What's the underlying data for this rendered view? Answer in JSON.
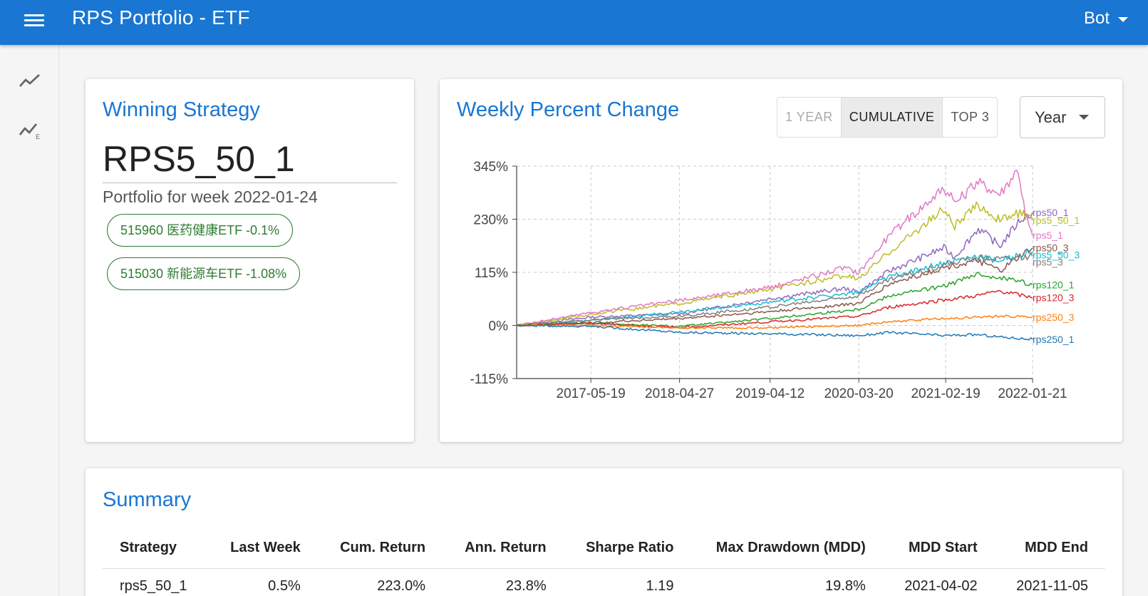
{
  "app": {
    "title": "RPS Portfolio - ETF",
    "user": "Bot"
  },
  "icons": {
    "menu": "hamburger-menu-icon",
    "nav_1": "trending-line-icon",
    "nav_2": "trending-line-e-icon"
  },
  "winning": {
    "title": "Winning Strategy",
    "strategy": "RPS5_50_1",
    "subtitle": "Portfolio for week 2022-01-24",
    "holdings": [
      "515960 医药健康ETF -0.1%",
      "515030 新能源车ETF -1.08%"
    ]
  },
  "chart_panel": {
    "title": "Weekly Percent Change",
    "toggles": [
      {
        "label": "1 YEAR",
        "state": "disabled"
      },
      {
        "label": "CUMULATIVE",
        "state": "active"
      },
      {
        "label": "TOP 3",
        "state": "normal"
      }
    ],
    "period_select": "Year"
  },
  "chart_data": {
    "type": "line",
    "title": "",
    "xlabel": "",
    "ylabel": "",
    "ylim": [
      -115,
      345
    ],
    "yticks": [
      -115,
      0,
      115,
      230,
      345
    ],
    "ytick_labels": [
      "-115%",
      "0%",
      "115%",
      "230%",
      "345%"
    ],
    "xticks": [
      "2017-05-19",
      "2018-04-27",
      "2019-04-12",
      "2020-03-20",
      "2021-02-19",
      "2022-01-21"
    ],
    "xlim": [
      "2016-08-05",
      "2022-01-21"
    ],
    "grid": true,
    "legend": "labels at line ends (right)",
    "series": [
      {
        "name": "rps50_1",
        "color": "#9467bd",
        "points": [
          [
            "2016-08-05",
            0
          ],
          [
            "2017-05-19",
            18
          ],
          [
            "2018-04-27",
            25
          ],
          [
            "2019-04-12",
            58
          ],
          [
            "2020-01-24",
            80
          ],
          [
            "2020-03-20",
            72
          ],
          [
            "2020-07-17",
            118
          ],
          [
            "2021-02-12",
            168
          ],
          [
            "2021-03-26",
            148
          ],
          [
            "2021-06-25",
            210
          ],
          [
            "2021-09-17",
            172
          ],
          [
            "2021-12-03",
            228
          ],
          [
            "2022-01-21",
            245
          ]
        ]
      },
      {
        "name": "rps5_50_1",
        "color": "#bcbd22",
        "points": [
          [
            "2016-08-05",
            0
          ],
          [
            "2017-05-19",
            24
          ],
          [
            "2018-04-27",
            48
          ],
          [
            "2019-04-12",
            78
          ],
          [
            "2020-01-24",
            108
          ],
          [
            "2020-03-20",
            100
          ],
          [
            "2020-07-17",
            160
          ],
          [
            "2021-02-12",
            252
          ],
          [
            "2021-03-26",
            215
          ],
          [
            "2021-06-25",
            262
          ],
          [
            "2021-09-17",
            228
          ],
          [
            "2021-12-03",
            245
          ],
          [
            "2022-01-21",
            228
          ]
        ]
      },
      {
        "name": "rps5_1",
        "color": "#e377c2",
        "points": [
          [
            "2016-08-05",
            0
          ],
          [
            "2017-05-19",
            28
          ],
          [
            "2018-04-27",
            54
          ],
          [
            "2019-04-12",
            82
          ],
          [
            "2020-01-24",
            125
          ],
          [
            "2020-03-20",
            115
          ],
          [
            "2020-07-17",
            195
          ],
          [
            "2021-02-12",
            298
          ],
          [
            "2021-03-26",
            265
          ],
          [
            "2021-06-25",
            310
          ],
          [
            "2021-09-17",
            285
          ],
          [
            "2021-11-26",
            340
          ],
          [
            "2021-12-24",
            240
          ],
          [
            "2022-01-21",
            195
          ]
        ]
      },
      {
        "name": "rps50_3",
        "color": "#8c564b",
        "points": [
          [
            "2016-08-05",
            0
          ],
          [
            "2017-05-19",
            6
          ],
          [
            "2018-04-27",
            15
          ],
          [
            "2019-04-12",
            30
          ],
          [
            "2020-03-20",
            48
          ],
          [
            "2020-07-17",
            90
          ],
          [
            "2021-02-12",
            125
          ],
          [
            "2021-06-25",
            140
          ],
          [
            "2021-09-17",
            118
          ],
          [
            "2022-01-21",
            168
          ]
        ]
      },
      {
        "name": "rps5_50_3",
        "color": "#17becf",
        "points": [
          [
            "2016-08-05",
            0
          ],
          [
            "2017-05-19",
            10
          ],
          [
            "2018-04-27",
            30
          ],
          [
            "2019-04-12",
            50
          ],
          [
            "2020-03-20",
            72
          ],
          [
            "2020-07-17",
            105
          ],
          [
            "2021-02-12",
            135
          ],
          [
            "2021-06-25",
            150
          ],
          [
            "2021-09-17",
            140
          ],
          [
            "2022-01-21",
            160
          ]
        ]
      },
      {
        "name": "rps5_3",
        "color": "#7f7f7f",
        "points": [
          [
            "2016-08-05",
            0
          ],
          [
            "2017-05-19",
            12
          ],
          [
            "2018-04-27",
            20
          ],
          [
            "2019-04-12",
            40
          ],
          [
            "2020-03-20",
            65
          ],
          [
            "2020-07-17",
            100
          ],
          [
            "2021-02-12",
            130
          ],
          [
            "2021-06-25",
            148
          ],
          [
            "2021-09-17",
            145
          ],
          [
            "2022-01-21",
            150
          ]
        ]
      },
      {
        "name": "rps120_1",
        "color": "#2ca02c",
        "points": [
          [
            "2016-08-05",
            0
          ],
          [
            "2017-05-19",
            5
          ],
          [
            "2018-04-27",
            -2
          ],
          [
            "2019-04-12",
            15
          ],
          [
            "2020-03-20",
            35
          ],
          [
            "2020-07-17",
            65
          ],
          [
            "2021-02-12",
            85
          ],
          [
            "2021-06-25",
            110
          ],
          [
            "2021-09-17",
            105
          ],
          [
            "2022-01-21",
            88
          ]
        ]
      },
      {
        "name": "rps120_3",
        "color": "#d62728",
        "points": [
          [
            "2016-08-05",
            0
          ],
          [
            "2017-05-19",
            5
          ],
          [
            "2018-04-27",
            -5
          ],
          [
            "2019-04-12",
            8
          ],
          [
            "2020-03-20",
            20
          ],
          [
            "2020-07-17",
            40
          ],
          [
            "2021-02-12",
            55
          ],
          [
            "2021-06-25",
            65
          ],
          [
            "2021-09-17",
            75
          ],
          [
            "2022-01-21",
            60
          ]
        ]
      },
      {
        "name": "rps250_3",
        "color": "#ff7f0e",
        "points": [
          [
            "2016-08-05",
            0
          ],
          [
            "2017-05-19",
            0
          ],
          [
            "2018-04-27",
            -5
          ],
          [
            "2019-04-12",
            -5
          ],
          [
            "2020-03-20",
            0
          ],
          [
            "2020-07-17",
            8
          ],
          [
            "2021-02-12",
            15
          ],
          [
            "2021-06-25",
            18
          ],
          [
            "2021-09-17",
            20
          ],
          [
            "2022-01-21",
            18
          ]
        ]
      },
      {
        "name": "rps250_1",
        "color": "#1f77b4",
        "points": [
          [
            "2016-08-05",
            0
          ],
          [
            "2017-05-19",
            -2
          ],
          [
            "2018-04-27",
            -15
          ],
          [
            "2019-04-12",
            -18
          ],
          [
            "2020-03-20",
            -22
          ],
          [
            "2020-07-17",
            -15
          ],
          [
            "2021-02-12",
            -22
          ],
          [
            "2021-06-25",
            -20
          ],
          [
            "2021-09-17",
            -25
          ],
          [
            "2022-01-21",
            -30
          ]
        ]
      }
    ]
  },
  "summary": {
    "title": "Summary",
    "headers": [
      "Strategy",
      "Last Week",
      "Cum. Return",
      "Ann. Return",
      "Sharpe Ratio",
      "Max Drawdown (MDD)",
      "MDD Start",
      "MDD End"
    ],
    "rows": [
      [
        "rps5_50_1",
        "0.5%",
        "223.0%",
        "23.8%",
        "1.19",
        "19.8%",
        "2021-04-02",
        "2021-11-05"
      ]
    ],
    "neg_color": "#e00000"
  }
}
